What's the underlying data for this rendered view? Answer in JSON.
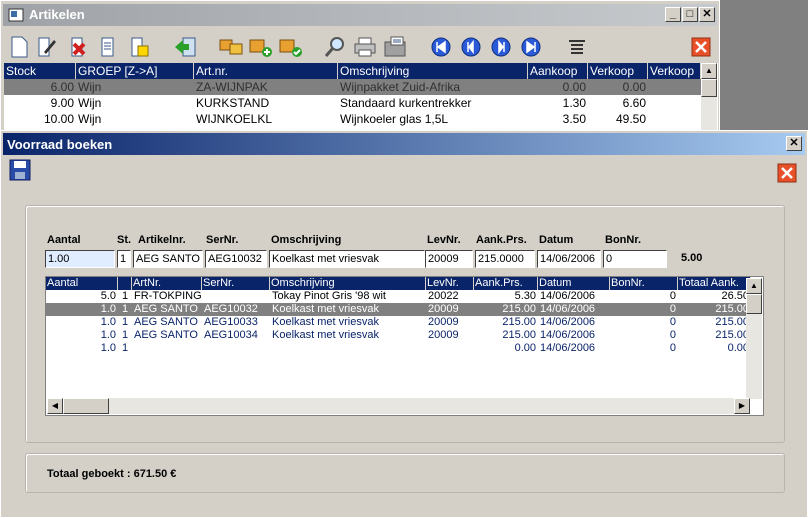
{
  "artikelen_window": {
    "title": "Artikelen",
    "columns": [
      "Stock",
      "GROEP [Z->A]",
      "Art.nr.",
      "Omschrijving",
      "Aankoop",
      "Verkoop",
      "Verkoop"
    ],
    "rows": [
      [
        "6.00",
        "Wijn",
        "ZA-WIJNPAK",
        "Wijnpakket Zuid-Afrika",
        "0.00",
        "0.00"
      ],
      [
        "9.00",
        "Wijn",
        "KURKSTAND",
        "Standaard kurkentrekker",
        "1.30",
        "6.60"
      ],
      [
        "10.00",
        "Wijn",
        "WIJNKOELKL",
        "Wijnkoeler glas 1,5L",
        "3.50",
        "49.50"
      ]
    ]
  },
  "voorraad_window": {
    "title": "Voorraad boeken",
    "form": {
      "labels": [
        "Aantal",
        "St.",
        "Artikelnr.",
        "SerNr.",
        "Omschrijving",
        "LevNr.",
        "Aank.Prs.",
        "Datum",
        "BonNr."
      ],
      "values": [
        "1.00",
        "1",
        "AEG SANTO",
        "AEG10032",
        "Koelkast met vriesvak",
        "20009",
        "215.0000",
        "14/06/2006",
        "0"
      ],
      "total_line": "5.00"
    },
    "grid": {
      "columns": [
        "Aantal",
        "",
        "ArtNr.",
        "SerNr.",
        "Omschrijving",
        "LevNr.",
        "Aank.Prs.",
        "Datum",
        "BonNr.",
        "Totaal Aank."
      ],
      "rows": [
        [
          "5.0",
          "1",
          "FR-TOKPINGF",
          "",
          "Tokay Pinot Gris '98 wit",
          "20022",
          "5.30",
          "14/06/2006",
          "0",
          "26.50"
        ],
        [
          "1.0",
          "1",
          "AEG SANTO",
          "AEG10032",
          "Koelkast met vriesvak",
          "20009",
          "215.00",
          "14/06/2006",
          "0",
          "215.00"
        ],
        [
          "1.0",
          "1",
          "AEG SANTO",
          "AEG10033",
          "Koelkast met vriesvak",
          "20009",
          "215.00",
          "14/06/2006",
          "0",
          "215.00"
        ],
        [
          "1.0",
          "1",
          "AEG SANTO",
          "AEG10034",
          "Koelkast met vriesvak",
          "20009",
          "215.00",
          "14/06/2006",
          "0",
          "215.00"
        ],
        [
          "1.0",
          "1",
          "",
          "",
          "",
          "",
          "0.00",
          "14/06/2006",
          "0",
          "0.00"
        ]
      ]
    },
    "total_label": "Totaal geboekt : 671.50 €"
  },
  "colors": {
    "active_title": "#0a246a",
    "inactive_title": "#9fa3a8",
    "selected_row": "#808080",
    "window_bg": "#d4d0c8"
  },
  "icons": [
    "new-document-icon",
    "edit-icon",
    "delete-icon",
    "copy-icon",
    "report-icon",
    "import-icon",
    "boxes-icon",
    "add-box-icon",
    "check-box-icon",
    "search-icon",
    "print-icon",
    "fax-icon",
    "first-icon",
    "previous-icon",
    "next-icon",
    "last-icon",
    "columns-icon",
    "close-icon",
    "save-icon"
  ]
}
